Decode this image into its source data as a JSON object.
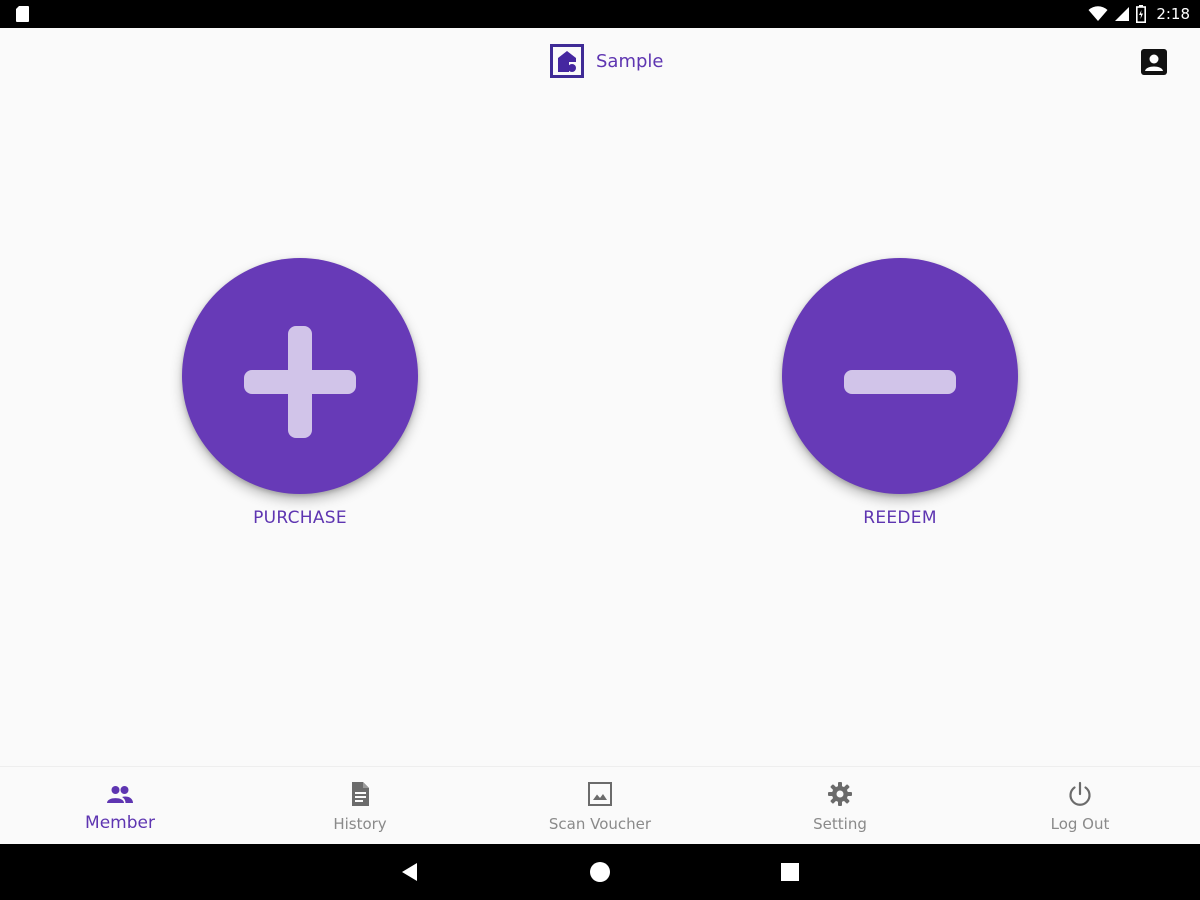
{
  "status_bar": {
    "time": "2:18",
    "icons": [
      "sd-card-icon",
      "wifi-icon",
      "signal-icon",
      "battery-icon"
    ]
  },
  "app_bar": {
    "title": "Sample",
    "logo_icon": "app-logo-icon",
    "profile_icon": "account-box-icon"
  },
  "actions": {
    "purchase": {
      "label": "PURCHASE",
      "icon": "plus-icon"
    },
    "redeem": {
      "label": "REEDEM",
      "icon": "minus-icon"
    }
  },
  "bottom_nav": {
    "active": "Member",
    "items": [
      {
        "label": "Member",
        "icon": "people-icon"
      },
      {
        "label": "History",
        "icon": "document-icon"
      },
      {
        "label": "Scan Voucher",
        "icon": "image-icon"
      },
      {
        "label": "Setting",
        "icon": "gear-icon"
      },
      {
        "label": "Log Out",
        "icon": "power-icon"
      }
    ]
  },
  "system_nav": {
    "icons": [
      "back-icon",
      "home-icon",
      "recents-icon"
    ]
  },
  "colors": {
    "accent": "#673ab7",
    "accent_text": "#5e35b1",
    "icon_glyph": "#d1c4e9",
    "inactive": "#8a8a8a",
    "background": "#fafafa"
  }
}
